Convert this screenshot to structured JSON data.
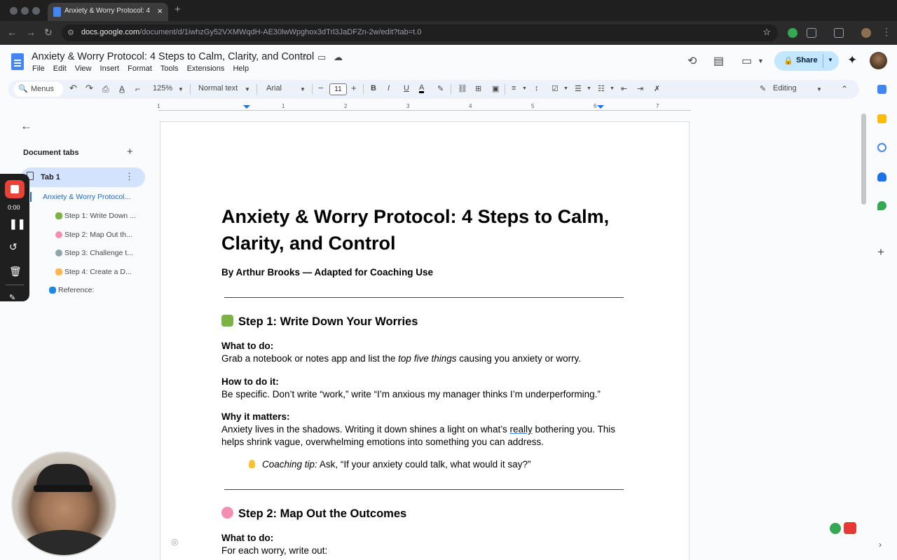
{
  "browser": {
    "tab_title": "Anxiety & Worry Protocol: 4 S",
    "url_domain": "docs.google.com",
    "url_path": "/document/d/1iwhzGy52VXMWqdH-AE30lwWpghox3dTrl3JaDFZn-2w/edit?tab=t.0"
  },
  "header": {
    "doc_title": "Anxiety & Worry Protocol: 4 Steps to Calm, Clarity, and Control",
    "menu": [
      "File",
      "Edit",
      "View",
      "Insert",
      "Format",
      "Tools",
      "Extensions",
      "Help"
    ],
    "share_label": "Share"
  },
  "toolbar": {
    "menus_label": "Menus",
    "zoom": "125%",
    "style": "Normal text",
    "font": "Arial",
    "font_size": "11",
    "mode": "Editing"
  },
  "ruler": {
    "numbers": [
      "1",
      "1",
      "2",
      "3",
      "4",
      "5",
      "6",
      "7"
    ]
  },
  "sidebar": {
    "heading": "Document tabs",
    "tab": "Tab 1",
    "outline": [
      "Anxiety & Worry Protocol...",
      "Step 1: Write Down ...",
      "Step 2: Map Out th...",
      "Step 3: Challenge t...",
      "Step 4: Create a D...",
      "Reference:"
    ]
  },
  "recorder": {
    "time": "0:00"
  },
  "document": {
    "title": "Anxiety & Worry Protocol: 4 Steps to Calm, Clarity, and Control",
    "byline": "By Arthur Brooks — Adapted for Coaching Use",
    "step1": {
      "heading": "Step 1: Write Down Your Worries",
      "what_label": "What to do:",
      "what_a": " Grab a notebook or notes app and list the ",
      "what_em": "top five things",
      "what_b": " causing you anxiety or worry.",
      "how_label": "How to do it:",
      "how_text": " Be specific. Don’t write “work,” write “I’m anxious my manager thinks I’m underperforming.”",
      "why_label": "Why it matters:",
      "why_a": " Anxiety lives in the shadows. Writing it down shines a light on what’s ",
      "why_ul": "really",
      "why_b": " bothering you. This helps shrink vague, overwhelming emotions into something you can address.",
      "tip_label": "Coaching tip:",
      "tip_text": " Ask, “If your anxiety could talk, what would it say?”"
    },
    "step2": {
      "heading": "Step 2: Map Out the Outcomes",
      "what_label": "What to do:",
      "what_text": " For each worry, write out:"
    }
  }
}
